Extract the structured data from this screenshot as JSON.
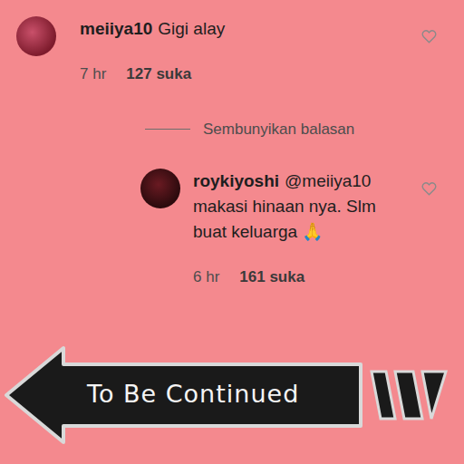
{
  "comment": {
    "username": "meiiya10",
    "text": "Gigi alay",
    "time": "7 hr",
    "likes": "127 suka",
    "liked": false
  },
  "replies_toggle": "Sembunyikan balasan",
  "reply": {
    "username": "roykiyoshi",
    "mention": "@meiiya10",
    "text": "makasi hinaan nya. Slm buat keluarga",
    "emoji": "🙏",
    "time": "6 hr",
    "likes": "161 suka",
    "liked": false
  },
  "banner": {
    "text": "To Be Continued"
  }
}
